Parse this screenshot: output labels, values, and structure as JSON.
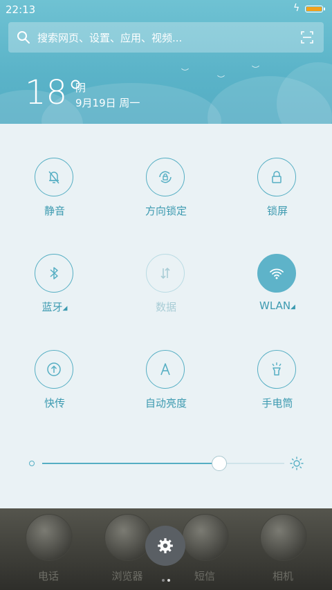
{
  "status_bar": {
    "time": "22:13",
    "charging_icon": "bolt-icon",
    "battery_color": "#f3a11d"
  },
  "search": {
    "placeholder": "搜索网页、设置、应用、视频..."
  },
  "weather": {
    "temperature": "18°",
    "condition": "阴",
    "date": "9月19日 周一"
  },
  "toggles": [
    {
      "label": "静音",
      "icon": "bell-off-icon",
      "state": "off"
    },
    {
      "label": "方向锁定",
      "icon": "rotation-lock-icon",
      "state": "off"
    },
    {
      "label": "锁屏",
      "icon": "lock-icon",
      "state": "off"
    },
    {
      "label": "蓝牙",
      "icon": "bluetooth-icon",
      "state": "off",
      "has_menu": true
    },
    {
      "label": "数据",
      "icon": "mobile-data-icon",
      "state": "disabled"
    },
    {
      "label": "WLAN",
      "icon": "wifi-icon",
      "state": "on",
      "has_menu": true
    },
    {
      "label": "快传",
      "icon": "quick-share-icon",
      "state": "off"
    },
    {
      "label": "自动亮度",
      "icon": "auto-brightness-icon",
      "state": "off"
    },
    {
      "label": "手电筒",
      "icon": "flashlight-icon",
      "state": "off"
    }
  ],
  "brightness": {
    "level": 0.73,
    "min_icon": "dim-icon",
    "max_icon": "sun-icon"
  },
  "dock": {
    "apps": [
      {
        "label": "电话"
      },
      {
        "label": "浏览器"
      },
      {
        "label": "短信"
      },
      {
        "label": "相机"
      }
    ]
  },
  "fab": {
    "icon": "gear-icon"
  },
  "pager": {
    "current": 2,
    "total": 2
  },
  "colors": {
    "accent": "#55aec3",
    "panel": "#eaf2f5",
    "sky": "#5ab3c8"
  }
}
